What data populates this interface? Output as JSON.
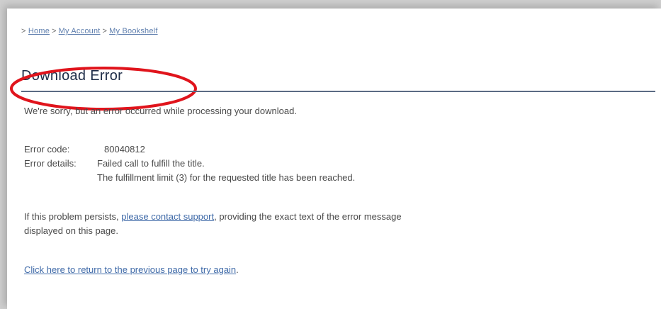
{
  "breadcrumb": {
    "prefix": ">",
    "separator": ">",
    "items": [
      "Home",
      "My Account",
      "My Bookshelf"
    ]
  },
  "page_title": "Download Error",
  "message": {
    "intro": "We're sorry, but an error occurred while processing your download.",
    "error_code_label": "Error code:",
    "error_code_value": "80040812",
    "error_details_label": "Error details:",
    "error_details_line1": "Failed call to fulfill the title.",
    "error_details_line2": "The fulfillment limit (3) for the requested title has been reached.",
    "persist_before": "If this problem persists,",
    "persist_link": "please contact support",
    "persist_after": ", providing the exact text of the error message",
    "persist_line2": "displayed on this page.",
    "return_link": "Click here to return to the previous page to try again",
    "return_after": "."
  },
  "colors": {
    "annotation": "#e0141c",
    "link": "#3f6aa8",
    "title": "#1d2c47",
    "rule": "#5b6b84"
  }
}
